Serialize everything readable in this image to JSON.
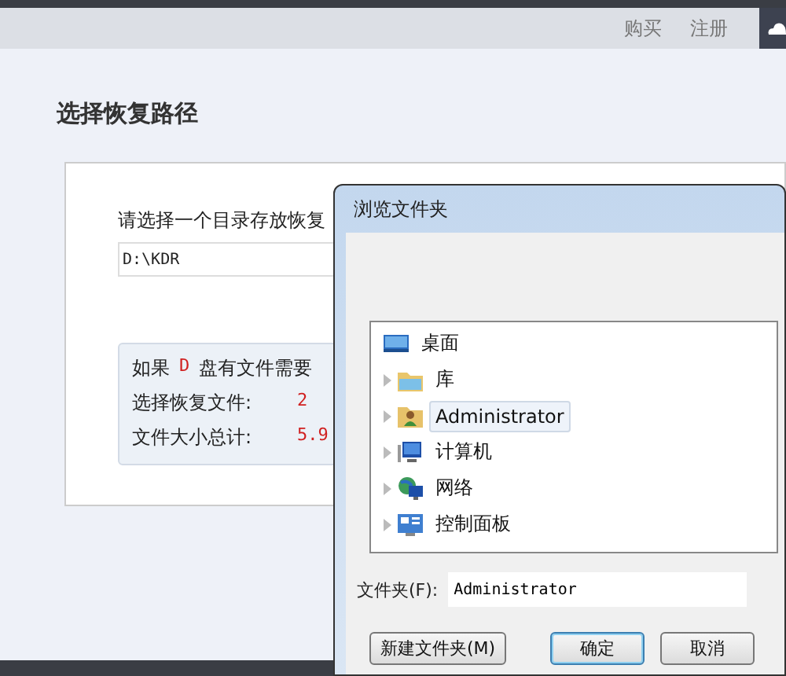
{
  "nav": {
    "links": [
      "购买",
      "注册"
    ]
  },
  "page": {
    "title": "选择恢复路径",
    "prompt": "请选择一个目录存放恢复",
    "path_field": {
      "value": "D:\\KDR"
    },
    "info": {
      "intro_before": "如果",
      "drive": "D",
      "intro_after": "盘有文件需要",
      "rows": [
        {
          "label": "选择恢复文件:",
          "value": "2"
        },
        {
          "label": "文件大小总计:",
          "value": "5.9"
        }
      ]
    }
  },
  "dialog": {
    "title": "浏览文件夹",
    "tree": [
      {
        "label": "桌面",
        "kind": "desktop",
        "selected": false,
        "children": [
          {
            "label": "库",
            "kind": "library",
            "selected": false,
            "expanded": false
          },
          {
            "label": "Administrator",
            "kind": "user",
            "selected": true,
            "expanded": false
          },
          {
            "label": "计算机",
            "kind": "computer",
            "selected": false,
            "expanded": false
          },
          {
            "label": "网络",
            "kind": "network",
            "selected": false,
            "expanded": false
          },
          {
            "label": "控制面板",
            "kind": "control-panel",
            "selected": false,
            "expanded": false
          }
        ]
      }
    ],
    "folder_label": "文件夹(F):",
    "folder_field": {
      "value": "Administrator"
    },
    "buttons": [
      {
        "label": "新建文件夹(M)",
        "default": false
      },
      {
        "label": "确定",
        "default": true
      },
      {
        "label": "取消",
        "default": false
      }
    ]
  }
}
